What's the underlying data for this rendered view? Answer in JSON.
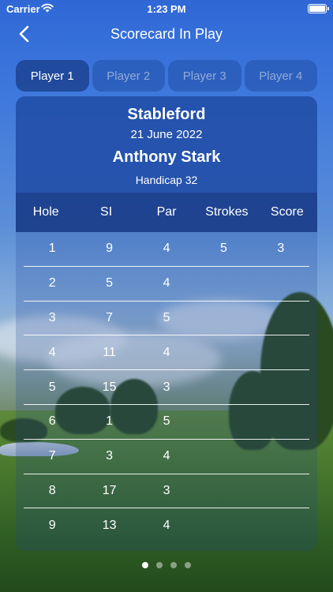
{
  "status": {
    "carrier": "Carrier",
    "time": "1:23 PM"
  },
  "nav": {
    "title": "Scorecard In Play",
    "back_icon": "chevron-left-icon"
  },
  "tabs": [
    {
      "label": "Player 1",
      "active": true
    },
    {
      "label": "Player 2",
      "active": false
    },
    {
      "label": "Player 3",
      "active": false
    },
    {
      "label": "Player 4",
      "active": false
    }
  ],
  "card": {
    "format": "Stableford",
    "date": "21 June 2022",
    "player_name": "Anthony Stark",
    "handicap": "Handicap 32"
  },
  "table": {
    "headers": [
      "Hole",
      "SI",
      "Par",
      "Strokes",
      "Score"
    ],
    "rows": [
      [
        "1",
        "9",
        "4",
        "5",
        "3"
      ],
      [
        "2",
        "5",
        "4",
        "",
        ""
      ],
      [
        "3",
        "7",
        "5",
        "",
        ""
      ],
      [
        "4",
        "11",
        "4",
        "",
        ""
      ],
      [
        "5",
        "15",
        "3",
        "",
        ""
      ],
      [
        "6",
        "1",
        "5",
        "",
        ""
      ],
      [
        "7",
        "3",
        "4",
        "",
        ""
      ],
      [
        "8",
        "17",
        "3",
        "",
        ""
      ],
      [
        "9",
        "13",
        "4",
        "",
        ""
      ]
    ]
  },
  "pager": {
    "pages": 4,
    "current": 1
  }
}
